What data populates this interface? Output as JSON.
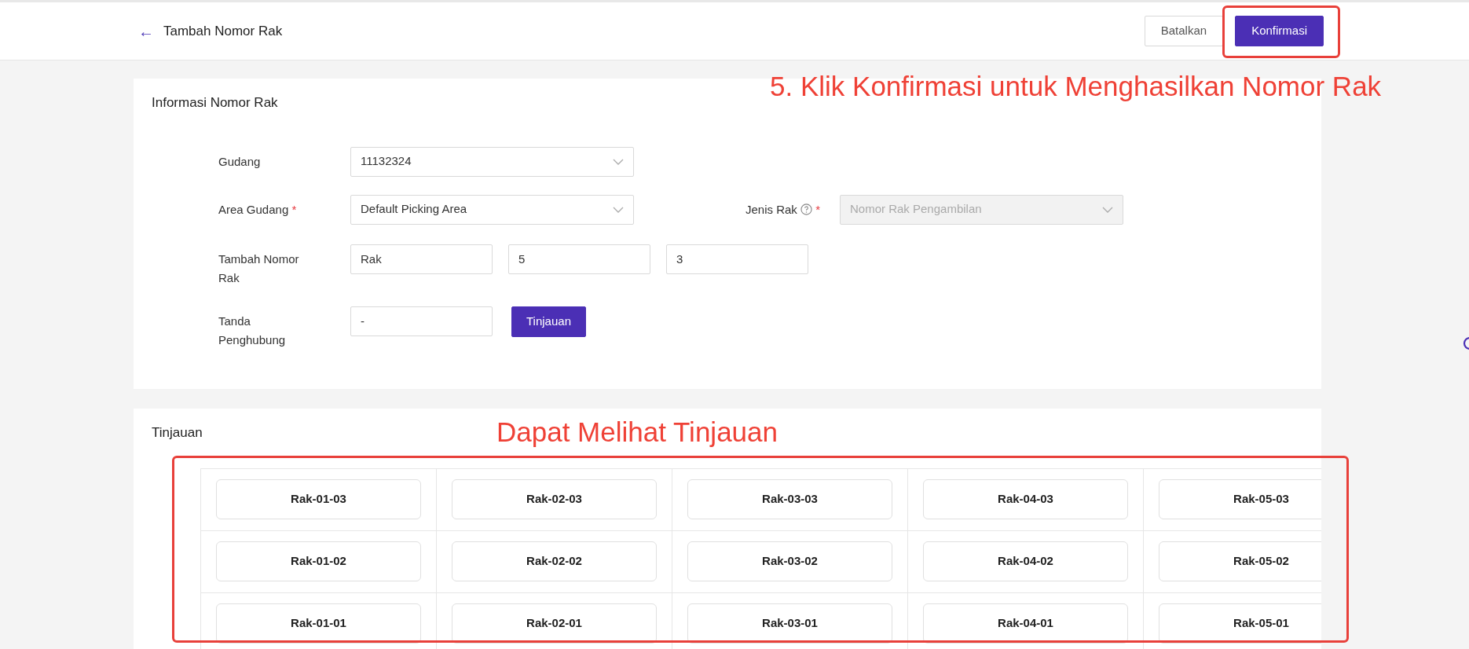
{
  "header": {
    "back_icon": "←",
    "title": "Tambah Nomor Rak",
    "buttons": [
      {
        "label": "Batalkan",
        "kind": "secondary"
      },
      {
        "label": "Konfirmasi",
        "kind": "primary"
      }
    ]
  },
  "info_section": {
    "title": "Informasi Nomor Rak",
    "gudang": {
      "label": "Gudang",
      "value": "11132324"
    },
    "area_gudang": {
      "label": "Area Gudang",
      "required_mark": "*",
      "value": "Default Picking Area"
    },
    "jenis_rak": {
      "label": "Jenis Rak",
      "required_mark": "*",
      "value": "Nomor Rak Pengambilan",
      "disabled": true
    },
    "tambah_nomor_rak": {
      "label": "Tambah Nomor Rak",
      "values": [
        "Rak",
        "5",
        "3"
      ]
    },
    "tanda_penghubung": {
      "label": "Tanda Penghubung",
      "value": "-"
    },
    "preview_button": "Tinjauan"
  },
  "preview_section": {
    "title": "Tinjauan",
    "rows": [
      [
        "Rak-01-03",
        "Rak-02-03",
        "Rak-03-03",
        "Rak-04-03",
        "Rak-05-03"
      ],
      [
        "Rak-01-02",
        "Rak-02-02",
        "Rak-03-02",
        "Rak-04-02",
        "Rak-05-02"
      ],
      [
        "Rak-01-01",
        "Rak-02-01",
        "Rak-03-01",
        "Rak-04-01",
        "Rak-05-01"
      ]
    ]
  },
  "annotations": [
    "5. Klik Konfirmasi untuk Menghasilkan Nomor Rak",
    "Dapat Melihat Tinjauan"
  ]
}
